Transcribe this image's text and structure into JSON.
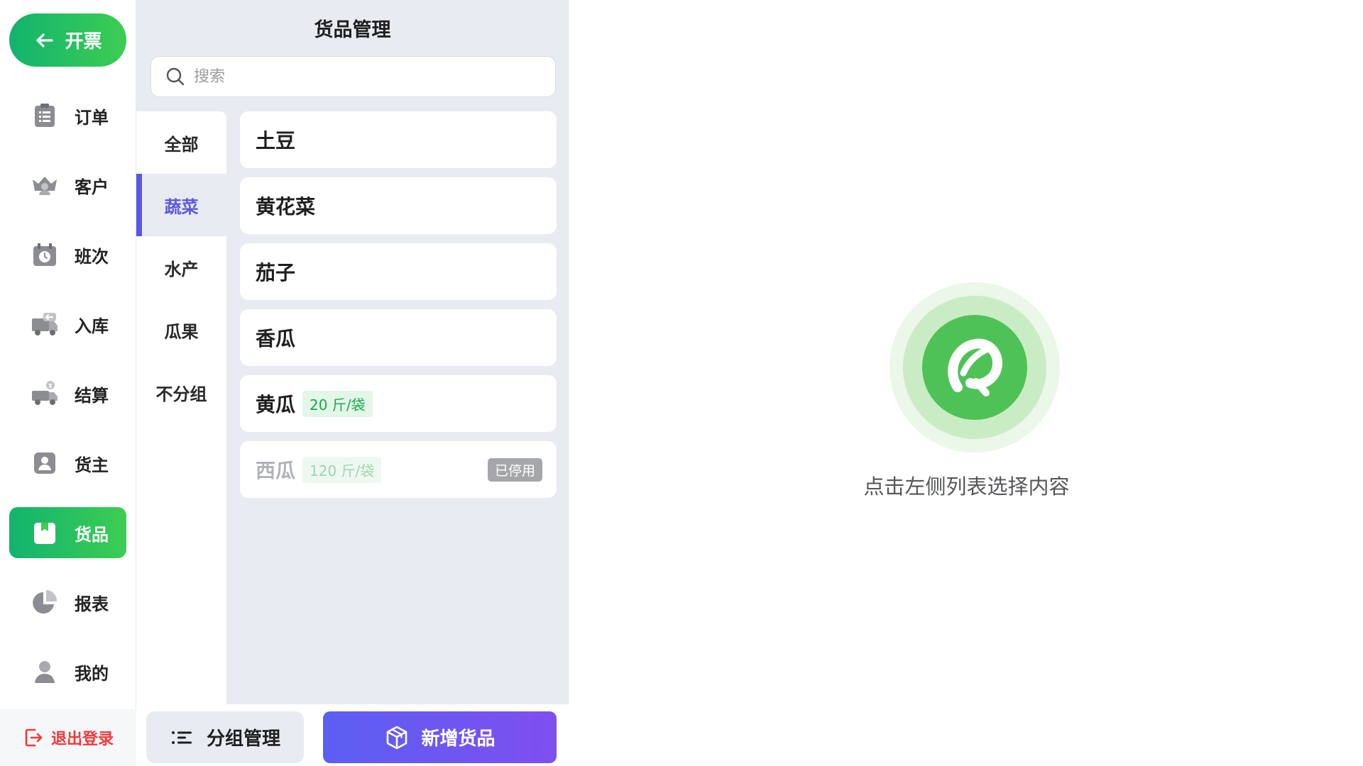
{
  "nav": {
    "invoice_label": "开票",
    "items": [
      {
        "label": "订单",
        "icon": "clipboard-list-icon"
      },
      {
        "label": "客户",
        "icon": "crown-user-icon"
      },
      {
        "label": "班次",
        "icon": "calendar-clock-icon"
      },
      {
        "label": "入库",
        "icon": "truck-inbound-icon"
      },
      {
        "label": "结算",
        "icon": "truck-yuan-icon"
      },
      {
        "label": "货主",
        "icon": "owner-badge-icon"
      },
      {
        "label": "货品",
        "icon": "goods-box-icon",
        "active": true
      },
      {
        "label": "报表",
        "icon": "pie-chart-icon"
      },
      {
        "label": "我的",
        "icon": "user-icon"
      }
    ],
    "logout_label": "退出登录"
  },
  "panel": {
    "title": "货品管理",
    "search": {
      "placeholder": "搜索",
      "value": ""
    },
    "groups": [
      {
        "label": "全部"
      },
      {
        "label": "蔬菜",
        "active": true
      },
      {
        "label": "水产"
      },
      {
        "label": "瓜果"
      },
      {
        "label": "不分组"
      }
    ],
    "goods": [
      {
        "name": "土豆",
        "tag": "",
        "status": ""
      },
      {
        "name": "黄花菜",
        "tag": "",
        "status": ""
      },
      {
        "name": "茄子",
        "tag": "",
        "status": ""
      },
      {
        "name": "香瓜",
        "tag": "",
        "status": ""
      },
      {
        "name": "黄瓜",
        "tag": "20 斤/袋",
        "status": ""
      },
      {
        "name": "西瓜",
        "tag": "120 斤/袋",
        "status": "已停用"
      }
    ],
    "footer": {
      "group_manage_label": "分组管理",
      "add_goods_label": "新增货品"
    }
  },
  "empty_state": {
    "text": "点击左侧列表选择内容"
  },
  "colors": {
    "green_accent": "#12b36e",
    "purple_accent": "#5b57e6",
    "logout_red": "#ee3a3a",
    "tag_green": "#1aa84a"
  }
}
